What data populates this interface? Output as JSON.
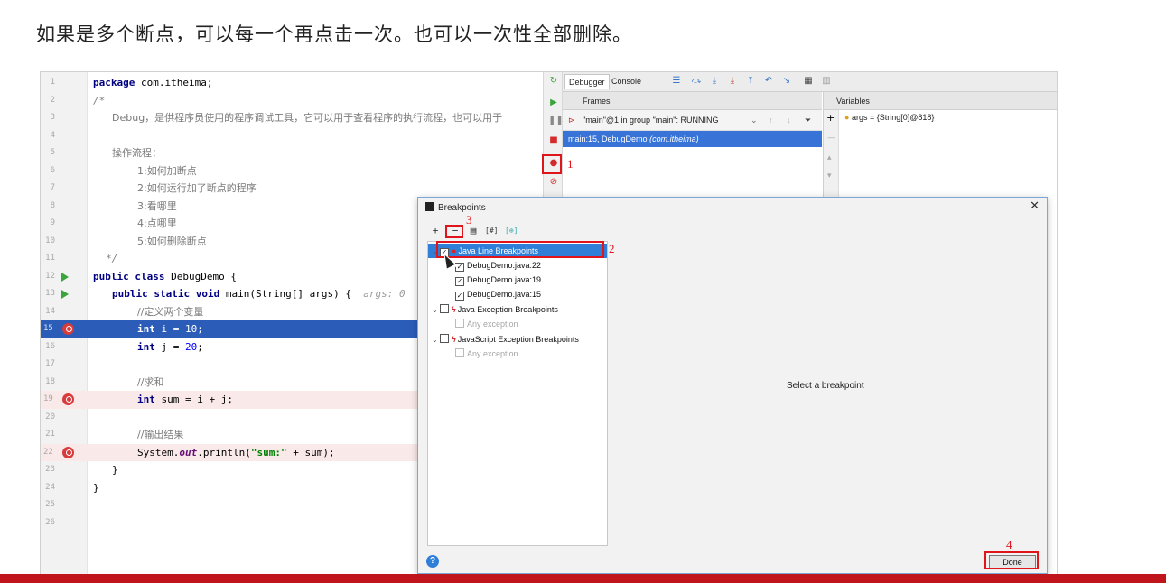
{
  "slide": {
    "title": "如果是多个断点，可以每一个再点击一次。也可以一次性全部删除。"
  },
  "editor": {
    "lines": [
      {
        "n": "1",
        "text": "package com.itheima;"
      },
      {
        "n": "2",
        "text": "/*"
      },
      {
        "n": "3",
        "text": "Debug，是供程序员使用的程序调试工具，它可以用于查看程序的执行流程，也可以用于"
      },
      {
        "n": "4",
        "text": ""
      },
      {
        "n": "5",
        "text": "操作流程："
      },
      {
        "n": "6",
        "text": "1:如何加断点"
      },
      {
        "n": "7",
        "text": "2:如何运行加了断点的程序"
      },
      {
        "n": "8",
        "text": "3:看哪里"
      },
      {
        "n": "9",
        "text": "4:点哪里"
      },
      {
        "n": "10",
        "text": "5:如何删除断点"
      },
      {
        "n": "11",
        "text": "*/"
      },
      {
        "n": "12",
        "text": "public class DebugDemo {"
      },
      {
        "n": "13",
        "text": "public static void main(String[] args) {"
      },
      {
        "n": "14",
        "text": "//定义两个变量"
      },
      {
        "n": "15",
        "text": "int i = 10;"
      },
      {
        "n": "16",
        "text": "int j = 20;"
      },
      {
        "n": "17",
        "text": ""
      },
      {
        "n": "18",
        "text": "//求和"
      },
      {
        "n": "19",
        "text": "int sum = i + j;"
      },
      {
        "n": "20",
        "text": ""
      },
      {
        "n": "21",
        "text": "//输出结果"
      },
      {
        "n": "22",
        "text": "System.out.println(\"sum:\" + sum);"
      },
      {
        "n": "23",
        "text": "}"
      },
      {
        "n": "24",
        "text": "}"
      },
      {
        "n": "25",
        "text": ""
      },
      {
        "n": "26",
        "text": ""
      }
    ],
    "hint_args": "args: 0",
    "kw_package": "package",
    "pkg_name": " com.itheima;",
    "kw_public": "public",
    "kw_class": "class",
    "kw_static": "static",
    "kw_void": "void",
    "kw_int": "int",
    "class_decl": " DebugDemo {",
    "main_decl": " main(String[] args) {",
    "var_i": " i = ",
    "val_i": "10",
    "var_j": " j = ",
    "val_j": "20",
    "sum_decl": " sum = i + j;",
    "println_pre": "System.",
    "println_out": "out",
    "println_mid": ".println(",
    "println_str": "\"sum:\"",
    "println_post": " + sum);",
    "semi": ";"
  },
  "debugger": {
    "tab_debugger": "Debugger",
    "tab_console": "Console",
    "frames_label": "Frames",
    "thread_label": "\"main\"@1 in group \"main\": RUNNING",
    "frame_entry": "main:15, DebugDemo",
    "frame_pkg": "(com.itheima)",
    "variables_label": "Variables",
    "var_args": "args = {String[0]@818}"
  },
  "dialog": {
    "title": "Breakpoints",
    "tree": {
      "java_line": "Java Line Breakpoints",
      "items": [
        "DebugDemo.java:22",
        "DebugDemo.java:19",
        "DebugDemo.java:15"
      ],
      "java_exception": "Java Exception Breakpoints",
      "any_exception": "Any exception",
      "js_exception": "JavaScript Exception Breakpoints",
      "any_exception_2": "Any exception"
    },
    "detail_text": "Select a breakpoint",
    "done_label": "Done",
    "help_label": "?",
    "close_label": "✕"
  },
  "annotations": {
    "n1": "1",
    "n2": "2",
    "n3": "3",
    "n4": "4"
  },
  "colors": {
    "accent_red": "#e0141b",
    "selection_blue": "#2f7fd8",
    "current_line": "#2a5cb8"
  }
}
